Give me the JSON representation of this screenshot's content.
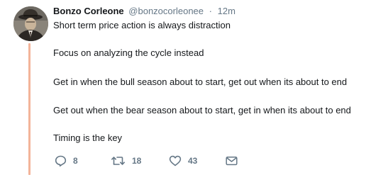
{
  "tweet": {
    "author": {
      "name": "Bonzo Corleone",
      "handle": "@bonzocorleonee",
      "separator": "·",
      "time": "12m",
      "avatar": "avatar-photo"
    },
    "lines": [
      "Short term price action is always distraction",
      "Focus on analyzing the cycle instead",
      "Get in when the bull season about to start, get out when its about to end",
      "Get out when the bear season about to start, get in when its about to end",
      "Timing is the key"
    ],
    "actions": {
      "reply": {
        "icon": "reply-icon",
        "count": "8"
      },
      "retweet": {
        "icon": "retweet-icon",
        "count": "18"
      },
      "like": {
        "icon": "heart-icon",
        "count": "43"
      },
      "message": {
        "icon": "envelope-icon"
      }
    },
    "colors": {
      "thread_line": "#f3b49a",
      "secondary_text": "#657786",
      "primary_text": "#14171a"
    }
  }
}
